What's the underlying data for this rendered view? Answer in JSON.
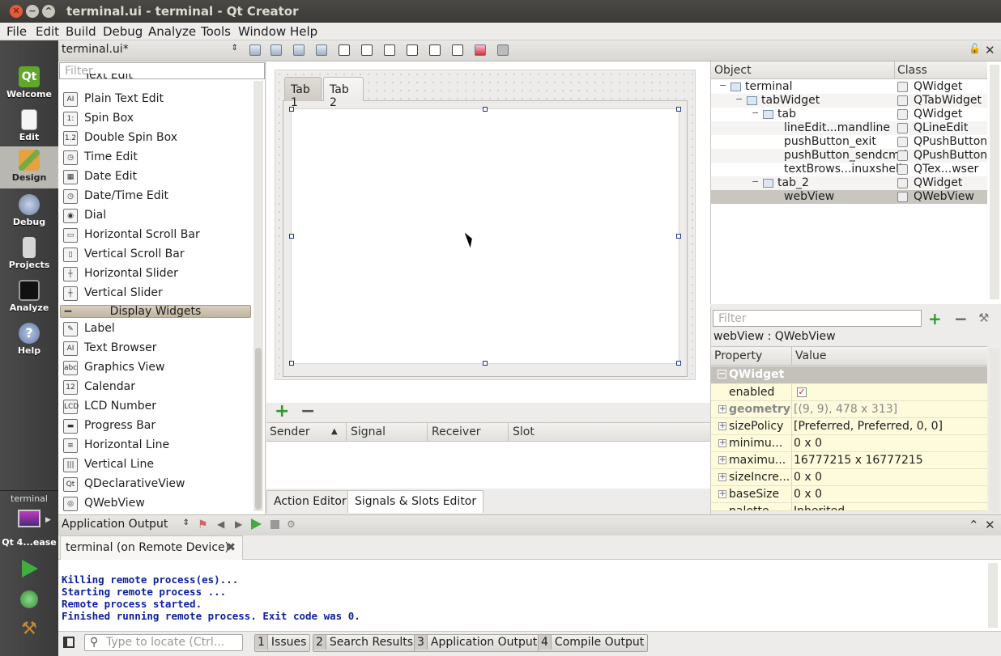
{
  "window": {
    "title": "terminal.ui - terminal - Qt Creator"
  },
  "menu": [
    "File",
    "Edit",
    "Build",
    "Debug",
    "Analyze",
    "Tools",
    "Window",
    "Help"
  ],
  "modes": [
    {
      "label": "Welcome",
      "icon": "qt-logo-icon"
    },
    {
      "label": "Edit",
      "icon": "document-icon"
    },
    {
      "label": "Design",
      "icon": "pencil-icon"
    },
    {
      "label": "Debug",
      "icon": "bug-icon"
    },
    {
      "label": "Projects",
      "icon": "wrench-icon"
    },
    {
      "label": "Analyze",
      "icon": "monitor-icon"
    },
    {
      "label": "Help",
      "icon": "help-icon"
    }
  ],
  "kit": {
    "project": "terminal",
    "target": "Qt 4...ease"
  },
  "toolbar": {
    "file": "terminal.ui*"
  },
  "widgetbox": {
    "filter_placeholder": "Filter",
    "partial_item": "Text Edit",
    "items": [
      {
        "label": "Plain Text Edit",
        "glyph": "AI"
      },
      {
        "label": "Spin Box",
        "glyph": "1:"
      },
      {
        "label": "Double Spin Box",
        "glyph": "1.2"
      },
      {
        "label": "Time Edit",
        "glyph": "◷"
      },
      {
        "label": "Date Edit",
        "glyph": "▦"
      },
      {
        "label": "Date/Time Edit",
        "glyph": "◷"
      },
      {
        "label": "Dial",
        "glyph": "◉"
      },
      {
        "label": "Horizontal Scroll Bar",
        "glyph": "▭"
      },
      {
        "label": "Vertical Scroll Bar",
        "glyph": "▯"
      },
      {
        "label": "Horizontal Slider",
        "glyph": "┼"
      },
      {
        "label": "Vertical Slider",
        "glyph": "┼"
      }
    ],
    "category": "Display Widgets",
    "display_items": [
      {
        "label": "Label",
        "glyph": "✎"
      },
      {
        "label": "Text Browser",
        "glyph": "AI"
      },
      {
        "label": "Graphics View",
        "glyph": "abc"
      },
      {
        "label": "Calendar",
        "glyph": "12"
      },
      {
        "label": "LCD Number",
        "glyph": "LCD"
      },
      {
        "label": "Progress Bar",
        "glyph": "▬"
      },
      {
        "label": "Horizontal Line",
        "glyph": "≡"
      },
      {
        "label": "Vertical Line",
        "glyph": "|||"
      },
      {
        "label": "QDeclarativeView",
        "glyph": "Qt"
      },
      {
        "label": "QWebView",
        "glyph": "◎"
      }
    ]
  },
  "form": {
    "tabs": [
      "Tab 1",
      "Tab 2"
    ],
    "active_tab": "Tab 2"
  },
  "signals": {
    "columns": [
      "Sender",
      "Signal",
      "Receiver",
      "Slot"
    ],
    "tabs": [
      "Action Editor",
      "Signals & Slots Editor"
    ],
    "active_tab": "Signals & Slots Editor"
  },
  "object_inspector": {
    "columns": [
      "Object",
      "Class"
    ],
    "rows": [
      {
        "object": "terminal",
        "class": "QWidget",
        "depth": 0,
        "toggle": "−"
      },
      {
        "object": "tabWidget",
        "class": "QTabWidget",
        "depth": 1,
        "toggle": "−"
      },
      {
        "object": "tab",
        "class": "QWidget",
        "depth": 2,
        "toggle": "−"
      },
      {
        "object": "lineEdit...mandline",
        "class": "QLineEdit",
        "depth": 3,
        "toggle": ""
      },
      {
        "object": "pushButton_exit",
        "class": "QPushButton",
        "depth": 3,
        "toggle": ""
      },
      {
        "object": "pushButton_sendcmd",
        "class": "QPushButton",
        "depth": 3,
        "toggle": ""
      },
      {
        "object": "textBrows...inuxshell",
        "class": "QTex...wser",
        "depth": 3,
        "toggle": ""
      },
      {
        "object": "tab_2",
        "class": "QWidget",
        "depth": 2,
        "toggle": "−"
      },
      {
        "object": "webView",
        "class": "QWebView",
        "depth": 3,
        "toggle": "",
        "selected": true
      }
    ]
  },
  "property_editor": {
    "filter_placeholder": "Filter",
    "object_class": "webView : QWebView",
    "columns": [
      "Property",
      "Value"
    ],
    "group": "QWidget",
    "rows": [
      {
        "name": "enabled",
        "value": "",
        "checkbox": true,
        "expand": ""
      },
      {
        "name": "geometry",
        "value": "[(9, 9), 478 x 313]",
        "bold": true,
        "expand": "+"
      },
      {
        "name": "sizePolicy",
        "value": "[Preferred, Preferred, 0, 0]",
        "expand": "+"
      },
      {
        "name": "minimu...",
        "value": "0 x 0",
        "expand": "+"
      },
      {
        "name": "maximu...",
        "value": "16777215 x 16777215",
        "expand": "+"
      },
      {
        "name": "sizeIncre...",
        "value": "0 x 0",
        "expand": "+"
      },
      {
        "name": "baseSize",
        "value": "0 x 0",
        "expand": "+"
      },
      {
        "name": "palette",
        "value": "Inherited",
        "expand": ""
      }
    ]
  },
  "output": {
    "pane": "Application Output",
    "tab": "terminal (on Remote Device)",
    "lines": [
      "Killing remote process(es)...",
      "Starting remote process ...",
      "Remote process started.",
      "Finished running remote process. Exit code was 0."
    ]
  },
  "statusbar": {
    "locate_placeholder": "Type to locate (Ctrl...",
    "buttons": [
      {
        "num": "1",
        "label": "Issues"
      },
      {
        "num": "2",
        "label": "Search Results"
      },
      {
        "num": "3",
        "label": "Application Output"
      },
      {
        "num": "4",
        "label": "Compile Output"
      }
    ]
  }
}
